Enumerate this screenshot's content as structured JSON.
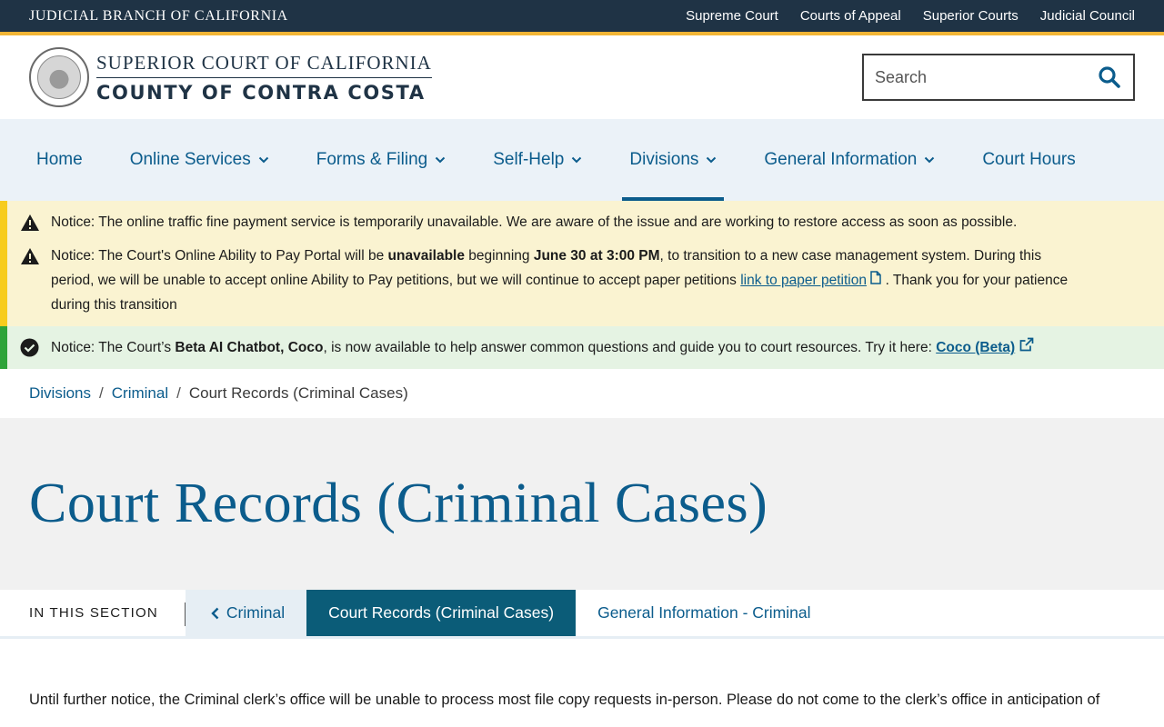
{
  "topbar": {
    "branch": "JUDICIAL BRANCH OF CALIFORNIA",
    "links": [
      "Supreme Court",
      "Courts of Appeal",
      "Superior Courts",
      "Judicial Council"
    ]
  },
  "header": {
    "line1": "SUPERIOR COURT OF CALIFORNIA",
    "line2": "COUNTY OF CONTRA COSTA",
    "search_placeholder": "Search"
  },
  "nav": {
    "items": [
      {
        "label": "Home"
      },
      {
        "label": "Online Services"
      },
      {
        "label": "Forms & Filing"
      },
      {
        "label": "Self-Help"
      },
      {
        "label": "Divisions"
      },
      {
        "label": "General Information"
      },
      {
        "label": "Court Hours"
      }
    ]
  },
  "notices": {
    "n1": "Notice: The online traffic fine payment service is temporarily unavailable. We are aware of the issue and are working to restore access as soon as possible.",
    "n2": {
      "a": "Notice: The Court's Online Ability to Pay Portal will be ",
      "b": "unavailable",
      "c": " beginning ",
      "d": "June 30 at 3:00 PM",
      "e": ", to transition to a new case management system. During this period, we will be unable to accept online Ability to Pay petitions, but we will continue to accept paper petitions ",
      "link": "link to paper petition",
      "f": " . Thank you for your patience during this transition"
    },
    "n3": {
      "a": "Notice: The Court’s ",
      "b": "Beta AI Chatbot, Coco",
      "c": ", is now available to help answer common questions and guide you to court resources. Try it here: ",
      "link": "Coco (Beta)"
    }
  },
  "breadcrumb": {
    "items": [
      "Divisions",
      "Criminal"
    ],
    "current": "Court Records (Criminal Cases)"
  },
  "page_title": "Court Records (Criminal Cases)",
  "section_nav": {
    "label": "IN THIS SECTION",
    "back": "Criminal",
    "current": "Court Records (Criminal Cases)",
    "other": "General Information - Criminal"
  },
  "content": {
    "paragraph": "Until further notice, the Criminal clerk’s office will be unable to process most file copy requests in-person. Please do not come to the clerk’s office in anticipation of"
  },
  "colors": {
    "topbar": "#1f3345",
    "accent_gold": "#f2b535",
    "link_blue": "#0b5c8c",
    "nav_bg": "#ebf2f8",
    "warn_bg": "#faf3d1",
    "ok_bg": "#e5f3e3",
    "current_tab": "#0b5c78"
  }
}
